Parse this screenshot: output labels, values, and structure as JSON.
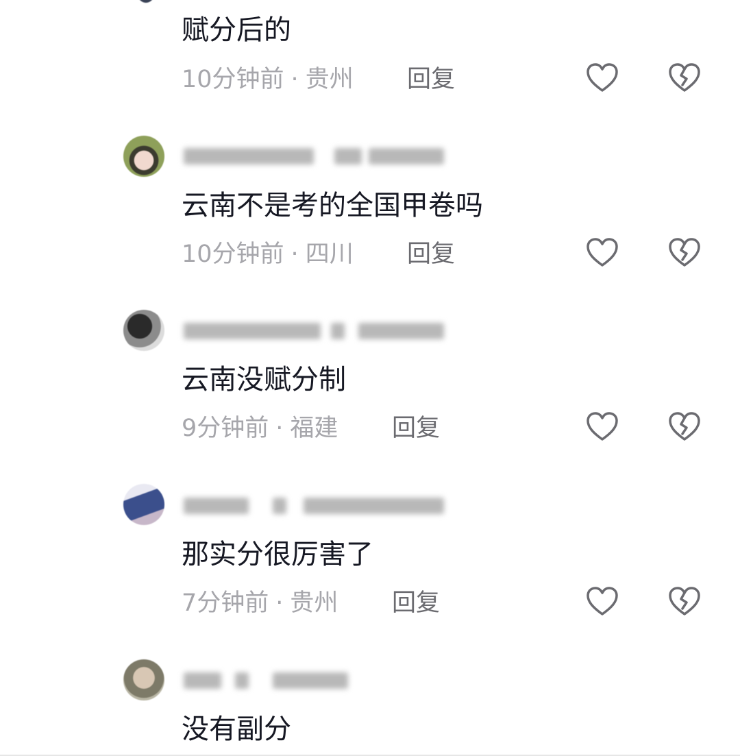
{
  "comments": [
    {
      "text": "赋分后的",
      "time": "10分钟前",
      "location": "贵州",
      "reply_label": "回复",
      "like_icon": "heart-outline-icon",
      "dislike_icon": "broken-heart-icon"
    },
    {
      "text": "云南不是考的全国甲卷吗",
      "time": "10分钟前",
      "location": "四川",
      "reply_label": "回复",
      "like_icon": "heart-outline-icon",
      "dislike_icon": "broken-heart-icon"
    },
    {
      "text": "云南没赋分制",
      "time": "9分钟前",
      "location": "福建",
      "reply_label": "回复",
      "like_icon": "heart-outline-icon",
      "dislike_icon": "broken-heart-icon"
    },
    {
      "text": "那实分很厉害了",
      "time": "7分钟前",
      "location": "贵州",
      "reply_label": "回复",
      "like_icon": "heart-outline-icon",
      "dislike_icon": "broken-heart-icon"
    },
    {
      "text": "没有副分"
    }
  ],
  "meta_separator": "·",
  "colors": {
    "text_primary": "#161823",
    "text_meta": "#a6a6ab",
    "reply": "#6b6b70",
    "icon_stroke": "#6b6b70"
  }
}
